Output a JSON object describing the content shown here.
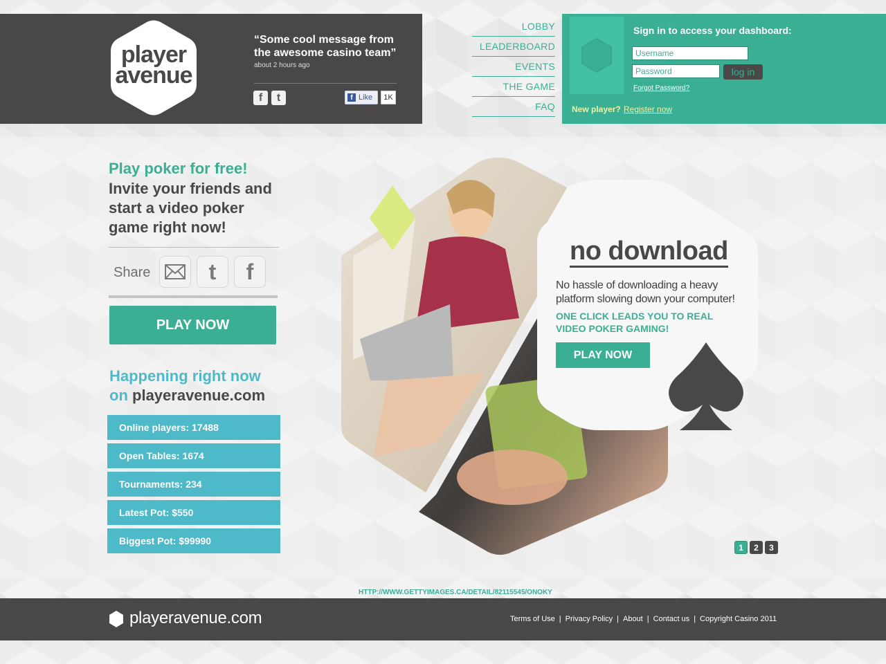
{
  "header": {
    "logo_line1": "player",
    "logo_line2": "avenue",
    "quote": "“Some cool message from the awesome casino team”",
    "quote_time": "about 2 hours ago",
    "fb_like_label": "Like",
    "fb_like_count": "1K"
  },
  "nav": {
    "items": [
      "LOBBY",
      "LEADERBOARD",
      "EVENTS",
      "THE GAME",
      "FAQ"
    ]
  },
  "login": {
    "title": "Sign in to access your dashboard:",
    "username_placeholder": "Username",
    "password_placeholder": "Password",
    "button": "log in",
    "forgot": "Forgot Password?",
    "new_player": "New player?",
    "register": "Register now"
  },
  "promo": {
    "headline_green": "Play poker for free!",
    "headline_dark": "Invite your friends and start a video poker game right now!",
    "share_label": "Share",
    "play_button": "PLAY NOW"
  },
  "happening": {
    "title": "Happening right now",
    "on": "on",
    "domain": "playeravenue.com",
    "stats": [
      "Online players: 17488",
      "Open Tables: 1674",
      "Tournaments: 234",
      "Latest Pot: $550",
      "Biggest Pot: $99990"
    ]
  },
  "hero": {
    "title": "no download",
    "text": "No hassle of downloading a heavy platform slowing down your computer!",
    "cta": "ONE CLICK LEADS YOU TO REAL VIDEO POKER GAMING!",
    "play_button": "PLAY NOW",
    "pages": [
      "1",
      "2",
      "3"
    ],
    "active_page": "1"
  },
  "credit": "HTTP://WWW.GETTYIMAGES.CA/DETAIL/82115545/ONOKY",
  "footer": {
    "domain": "playeravenue.com",
    "links": [
      "Terms of Use",
      "Privacy Policy",
      "About",
      "Contact us",
      "Copyright Casino 2011"
    ]
  },
  "colors": {
    "teal": "#3aaf94",
    "cyan": "#4db9c9",
    "dark": "#4a4748",
    "lime": "#dbeb82"
  }
}
